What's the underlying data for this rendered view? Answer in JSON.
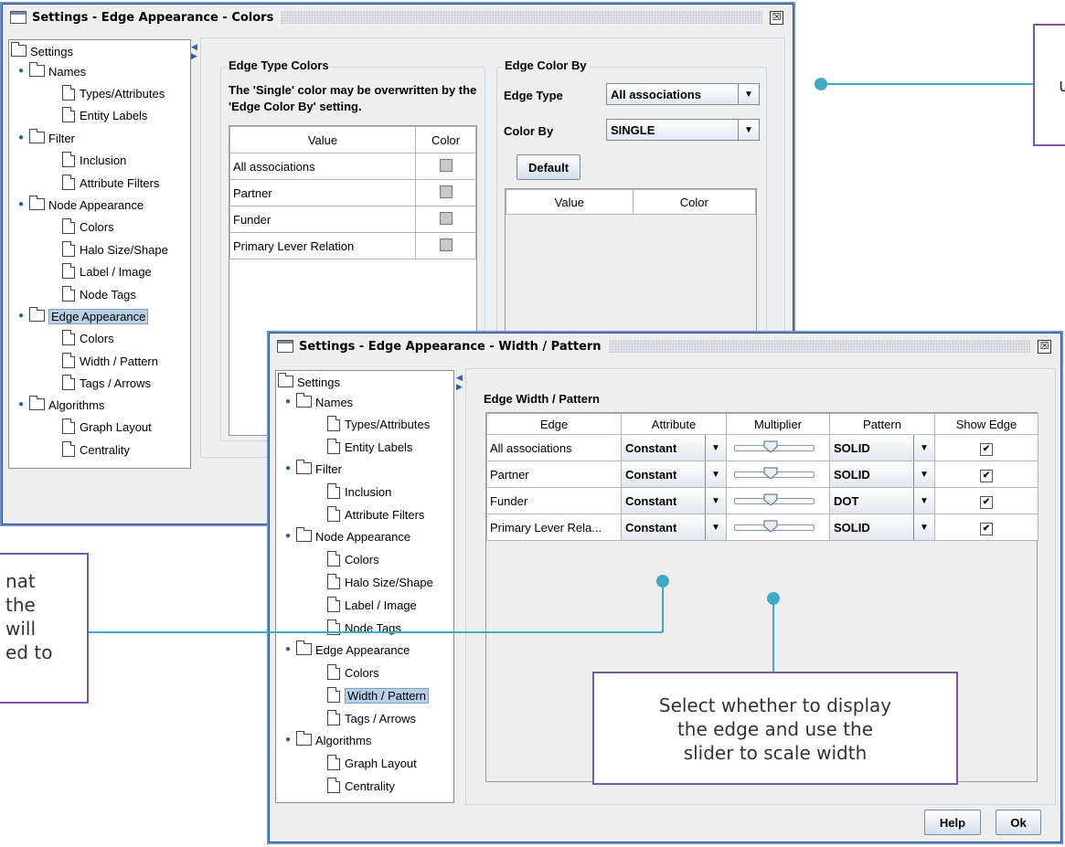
{
  "colors": {
    "accent": "#40a9c4",
    "callout_border": "#7b58a6",
    "window_border": "#2b4a8b"
  },
  "window1": {
    "title": "Settings - Edge Appearance - Colors",
    "close_glyph": "☒",
    "edge_type_colors_title": "Edge Type Colors",
    "note": "The 'Single' color may be overwritten by the 'Edge Color By' setting.",
    "table_headers": [
      "Value",
      "Color"
    ],
    "rows": [
      "All associations",
      "Partner",
      "Funder",
      "Primary Lever Relation"
    ],
    "edge_color_by_title": "Edge Color By",
    "edge_type_label": "Edge Type",
    "edge_type_value": "All associations",
    "color_by_label": "Color By",
    "color_by_value": "SINGLE",
    "default_button": "Default",
    "right_table_headers": [
      "Value",
      "Color"
    ]
  },
  "window2": {
    "title": "Settings - Edge Appearance - Width / Pattern",
    "close_glyph": "☒",
    "section_title": "Edge Width / Pattern",
    "headers": [
      "Edge",
      "Attribute",
      "Multiplier",
      "Pattern",
      "Show Edge"
    ],
    "rows": [
      {
        "edge": "All associations",
        "attribute": "Constant",
        "multiplier": 0.55,
        "pattern": "SOLID",
        "show": "✔"
      },
      {
        "edge": "Partner",
        "attribute": "Constant",
        "multiplier": 0.55,
        "pattern": "SOLID",
        "show": "✔"
      },
      {
        "edge": "Funder",
        "attribute": "Constant",
        "multiplier": 0.55,
        "pattern": "DOT",
        "show": "✔"
      },
      {
        "edge": "Primary Lever Rela...",
        "attribute": "Constant",
        "multiplier": 0.55,
        "pattern": "SOLID",
        "show": "✔"
      }
    ],
    "help_button": "Help",
    "ok_button": "Ok"
  },
  "tree": {
    "root": "Settings",
    "names": "Names",
    "types_attributes": "Types/Attributes",
    "entity_labels": "Entity Labels",
    "filter": "Filter",
    "inclusion": "Inclusion",
    "attribute_filters": "Attribute Filters",
    "node_appearance": "Node Appearance",
    "colors": "Colors",
    "halo": "Halo Size/Shape",
    "label_image": "Label / Image",
    "node_tags": "Node Tags",
    "edge_appearance": "Edge Appearance",
    "width_pattern": "Width / Pattern",
    "tags_arrows": "Tags / Arrows",
    "algorithms": "Algorithms",
    "graph_layout": "Graph Layout",
    "centrality": "Centrality"
  },
  "callouts": {
    "top_right_fragment": "u",
    "left_lines": [
      "nat",
      "the",
      "will",
      "ed to"
    ],
    "bottom_lines": [
      "Select whether to display",
      "the edge and use the",
      "slider to scale width"
    ]
  }
}
